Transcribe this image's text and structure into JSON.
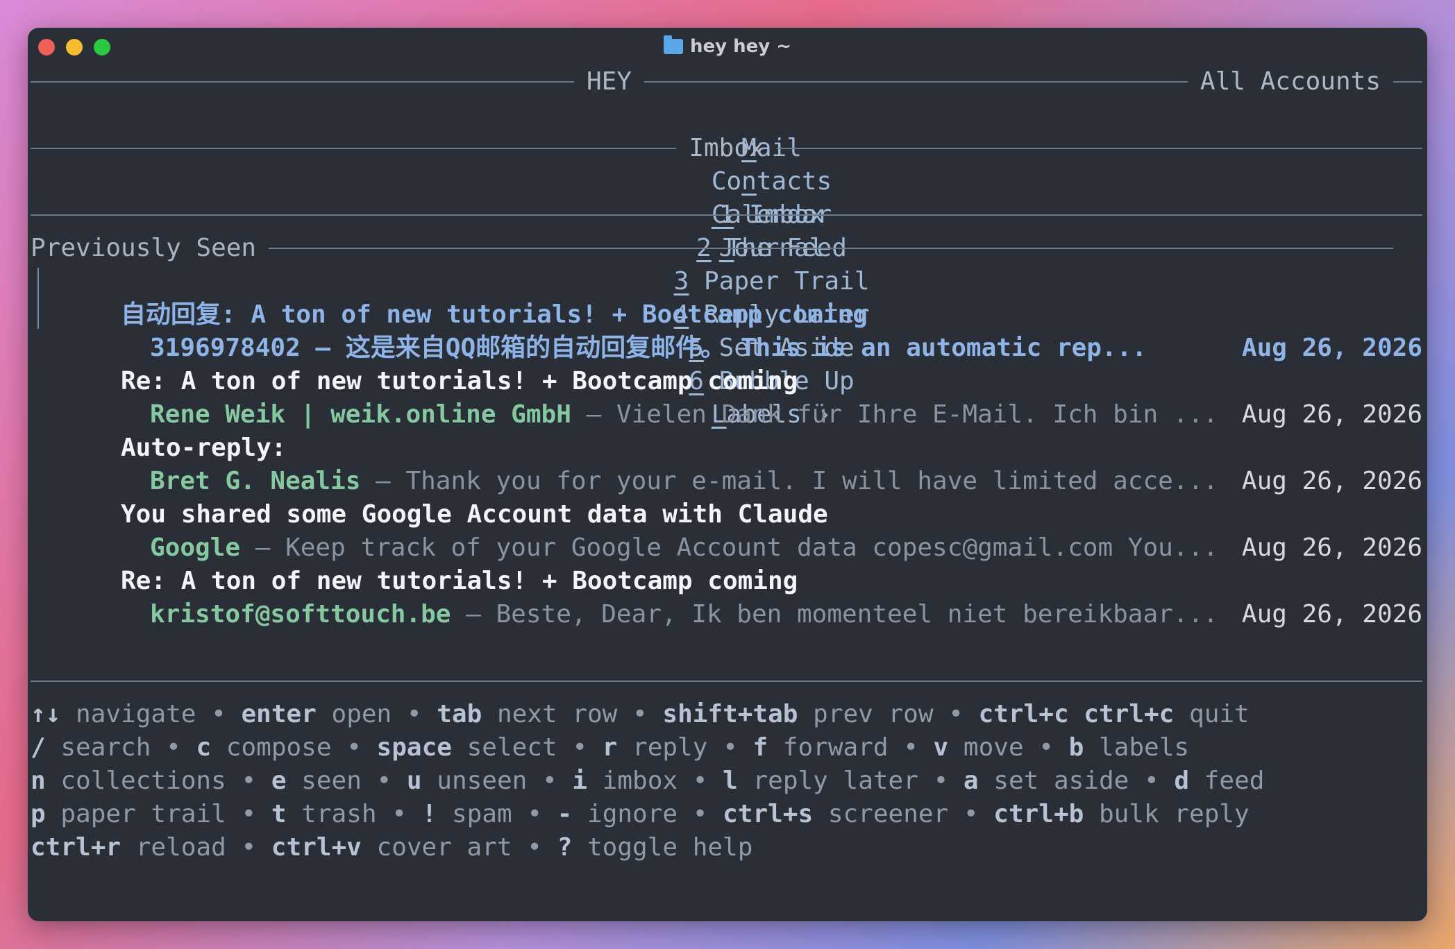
{
  "window": {
    "title": "hey hey ~"
  },
  "header": {
    "app_name": "HEY",
    "account": "All Accounts"
  },
  "nav": [
    {
      "label": "Mail",
      "key": "M",
      "rest": "ail"
    },
    {
      "label": "Contacts",
      "key": "n",
      "pre": "Co",
      "rest": "tacts"
    },
    {
      "label": "Calendar",
      "key": "C",
      "rest": "alendar"
    },
    {
      "label": "Journal",
      "key": "J",
      "rest": "ournal"
    }
  ],
  "box_title": "Imbox",
  "tabs": [
    {
      "num": "1",
      "label": " Imbox"
    },
    {
      "num": "2",
      "label": " The Feed"
    },
    {
      "num": "3",
      "label": " Paper Trail"
    },
    {
      "num": "4",
      "label": " Reply Later"
    },
    {
      "num": "5",
      "label": " Set Aside"
    },
    {
      "num": "6",
      "label": " Bubble Up"
    }
  ],
  "labels_tab": {
    "key": "L",
    "rest": "abels",
    "arrow": "›"
  },
  "section": "Previously Seen",
  "emails": [
    {
      "subject": "自动回复: A ton of new tutorials! + Bootcamp coming",
      "date": "Aug 26, 2026",
      "sender": "3196978402",
      "preview": " — 这是来自QQ邮箱的自动回复邮件。 This is an automatic rep...",
      "state": "selected"
    },
    {
      "subject": "Re: A ton of new tutorials! + Bootcamp coming",
      "date": "Aug 26, 2026",
      "sender": "Rene Weik | weik.online GmbH",
      "preview": " — Vielen Dank für Ihre E-Mail. Ich bin ...",
      "state": "read"
    },
    {
      "subject": "Auto-reply:",
      "date": "Aug 26, 2026",
      "sender": "Bret G. Nealis",
      "preview": " — Thank you for your e-mail. I will have limited acce...",
      "state": "read"
    },
    {
      "subject": "You shared some Google Account data with Claude",
      "date": "Aug 26, 2026",
      "sender": "Google",
      "preview": " — Keep track of your Google Account data copesc@gmail.com You...",
      "state": "read"
    },
    {
      "subject": "Re: A ton of new tutorials! + Bootcamp coming",
      "date": "Aug 26, 2026",
      "sender": "kristof@softtouch.be",
      "preview": " — Beste, Dear, Ik ben momenteel niet bereikbaar...",
      "state": "read"
    }
  ],
  "help": [
    [
      {
        "k": "↑↓",
        "d": "navigate"
      },
      {
        "k": "enter",
        "d": "open"
      },
      {
        "k": "tab",
        "d": "next row"
      },
      {
        "k": "shift+tab",
        "d": "prev row"
      },
      {
        "k": "ctrl+c ctrl+c",
        "d": "quit"
      }
    ],
    [
      {
        "k": "/",
        "d": "search"
      },
      {
        "k": "c",
        "d": "compose"
      },
      {
        "k": "space",
        "d": "select"
      },
      {
        "k": "r",
        "d": "reply"
      },
      {
        "k": "f",
        "d": "forward"
      },
      {
        "k": "v",
        "d": "move"
      },
      {
        "k": "b",
        "d": "labels"
      }
    ],
    [
      {
        "k": "n",
        "d": "collections"
      },
      {
        "k": "e",
        "d": "seen"
      },
      {
        "k": "u",
        "d": "unseen"
      },
      {
        "k": "i",
        "d": "imbox"
      },
      {
        "k": "l",
        "d": "reply later"
      },
      {
        "k": "a",
        "d": "set aside"
      },
      {
        "k": "d",
        "d": "feed"
      }
    ],
    [
      {
        "k": "p",
        "d": "paper trail"
      },
      {
        "k": "t",
        "d": "trash"
      },
      {
        "k": "!",
        "d": "spam"
      },
      {
        "k": "-",
        "d": "ignore"
      },
      {
        "k": "ctrl+s",
        "d": "screener"
      },
      {
        "k": "ctrl+b",
        "d": "bulk reply"
      }
    ],
    [
      {
        "k": "ctrl+r",
        "d": "reload"
      },
      {
        "k": "ctrl+v",
        "d": "cover art"
      },
      {
        "k": "?",
        "d": "toggle help"
      }
    ]
  ],
  "help_separator": "•"
}
